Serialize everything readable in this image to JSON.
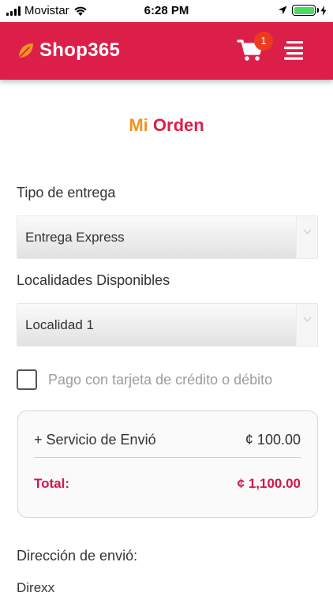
{
  "status_bar": {
    "carrier": "Movistar",
    "time": "6:28 PM",
    "icons": [
      "signal-icon",
      "wifi-icon",
      "location-icon",
      "battery-icon",
      "charging-icon"
    ]
  },
  "header": {
    "brand": "Shop365",
    "cart_count": "1",
    "icons": [
      "leaf-logo-icon",
      "cart-icon",
      "menu-icon"
    ],
    "colors": {
      "bar": "#dc1f49",
      "logo": "#f39323",
      "badge": "#ec3b1c"
    }
  },
  "order": {
    "title_part1": "Mi",
    "title_part2": "Orden",
    "colors": {
      "part1": "#f39323",
      "part2": "#dc1f49"
    }
  },
  "delivery": {
    "label": "Tipo de entrega",
    "selected": "Entrega Express"
  },
  "locality": {
    "label": "Localidades Disponibles",
    "selected": "Localidad 1"
  },
  "payment": {
    "label": "Pago con tarjeta de crédito o débito",
    "checked": false
  },
  "summary": {
    "shipping_label": "+ Servicio de Envió",
    "shipping_value": "¢ 100.00",
    "total_label": "Total:",
    "total_value": "¢ 1,100.00",
    "accent": "#d0174c"
  },
  "address": {
    "label": "Dirección de envió:",
    "value": "Direxx"
  }
}
